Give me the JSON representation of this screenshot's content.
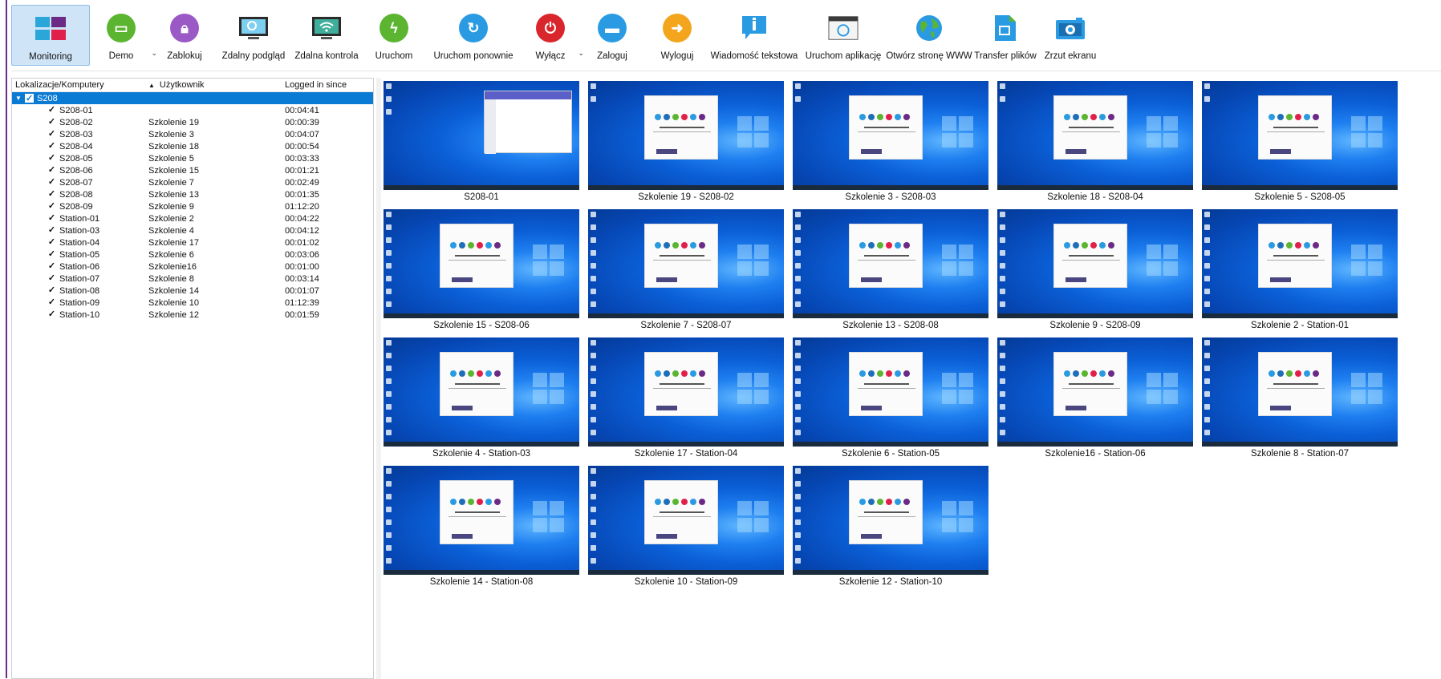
{
  "toolbar": {
    "items": [
      {
        "label": "Monitoring",
        "icon": "monitoring-icon",
        "active": true
      },
      {
        "label": "Demo",
        "icon": "presentation-icon",
        "dropdown": true
      },
      {
        "label": "Zablokuj",
        "icon": "lock-icon"
      },
      {
        "label": "Zdalny podgląd",
        "icon": "remote-view-icon"
      },
      {
        "label": "Zdalna kontrola",
        "icon": "remote-control-icon"
      },
      {
        "label": "Uruchom",
        "icon": "power-on-icon"
      },
      {
        "label": "Uruchom ponownie",
        "icon": "restart-icon"
      },
      {
        "label": "Wyłącz",
        "icon": "shutdown-icon",
        "dropdown": true
      },
      {
        "label": "Zaloguj",
        "icon": "login-icon"
      },
      {
        "label": "Wyloguj",
        "icon": "logout-icon"
      },
      {
        "label": "Wiadomość tekstowa",
        "icon": "message-icon"
      },
      {
        "label": "Uruchom aplikację",
        "icon": "run-app-icon"
      },
      {
        "label": "Otwórz stronę WWW",
        "icon": "globe-icon"
      },
      {
        "label": "Transfer plików",
        "icon": "file-transfer-icon"
      },
      {
        "label": "Zrzut ekranu",
        "icon": "camera-icon"
      }
    ]
  },
  "tree": {
    "columns": [
      "Lokalizacje/Komputery",
      "Użytkownik",
      "Logged in since"
    ],
    "group": "S208",
    "rows": [
      {
        "computer": "S208-01",
        "user": "",
        "since": "00:04:41"
      },
      {
        "computer": "S208-02",
        "user": "Szkolenie 19",
        "since": "00:00:39"
      },
      {
        "computer": "S208-03",
        "user": "Szkolenie 3",
        "since": "00:04:07"
      },
      {
        "computer": "S208-04",
        "user": "Szkolenie 18",
        "since": "00:00:54"
      },
      {
        "computer": "S208-05",
        "user": "Szkolenie 5",
        "since": "00:03:33"
      },
      {
        "computer": "S208-06",
        "user": "Szkolenie 15",
        "since": "00:01:21"
      },
      {
        "computer": "S208-07",
        "user": "Szkolenie 7",
        "since": "00:02:49"
      },
      {
        "computer": "S208-08",
        "user": "Szkolenie 13",
        "since": "00:01:35"
      },
      {
        "computer": "S208-09",
        "user": "Szkolenie 9",
        "since": "01:12:20"
      },
      {
        "computer": "Station-01",
        "user": "Szkolenie 2",
        "since": "00:04:22"
      },
      {
        "computer": "Station-03",
        "user": "Szkolenie 4",
        "since": "00:04:12"
      },
      {
        "computer": "Station-04",
        "user": "Szkolenie 17",
        "since": "00:01:02"
      },
      {
        "computer": "Station-05",
        "user": "Szkolenie 6",
        "since": "00:03:06"
      },
      {
        "computer": "Station-06",
        "user": "Szkolenie16",
        "since": "00:01:00"
      },
      {
        "computer": "Station-07",
        "user": "Szkolenie 8",
        "since": "00:03:14"
      },
      {
        "computer": "Station-08",
        "user": "Szkolenie 14",
        "since": "00:01:07"
      },
      {
        "computer": "Station-09",
        "user": "Szkolenie 10",
        "since": "01:12:39"
      },
      {
        "computer": "Station-10",
        "user": "Szkolenie 12",
        "since": "00:01:59"
      }
    ]
  },
  "thumbnails": [
    "S208-01",
    "Szkolenie 19 - S208-02",
    "Szkolenie 3 - S208-03",
    "Szkolenie 18 - S208-04",
    "Szkolenie 5 - S208-05",
    "Szkolenie 15 - S208-06",
    "Szkolenie 7 - S208-07",
    "Szkolenie 13 - S208-08",
    "Szkolenie 9 - S208-09",
    "Szkolenie 2 - Station-01",
    "Szkolenie 4 - Station-03",
    "Szkolenie 17 - Station-04",
    "Szkolenie 6 - Station-05",
    "Szkolenie16 - Station-06",
    "Szkolenie 8 - Station-07",
    "Szkolenie 14 - Station-08",
    "Szkolenie 10 - Station-09",
    "Szkolenie 12 - Station-10"
  ],
  "colors": {
    "selection": "#0a7bd4",
    "accent": "#6b2a86",
    "desktop": "#0b5fd6"
  }
}
